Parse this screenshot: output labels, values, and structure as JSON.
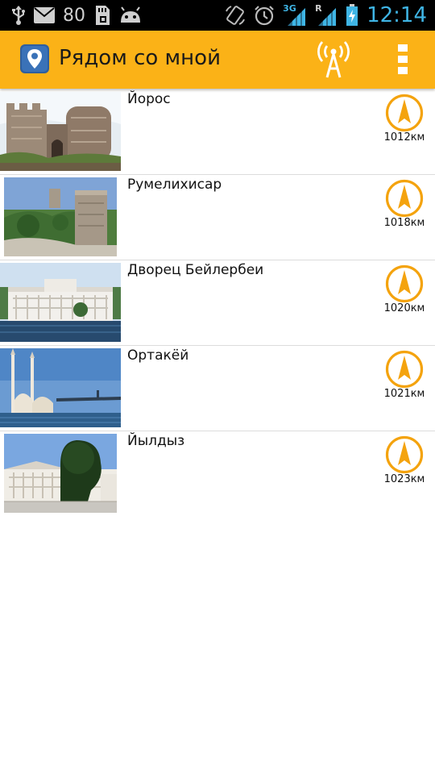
{
  "status_bar": {
    "battery_level": "80",
    "time": "12:14",
    "network": "3G",
    "roaming": "R",
    "icons": [
      "usb-icon",
      "mail-icon",
      "sd-card-icon",
      "android-icon",
      "rotate-icon",
      "alarm-icon",
      "signal-icon",
      "battery-icon"
    ]
  },
  "action_bar": {
    "title": "Рядом со мной",
    "icons": [
      "location-pin-icon",
      "antenna-icon",
      "overflow-menu-icon"
    ],
    "accent": "#fbb217"
  },
  "places": [
    {
      "name": "Йорос",
      "distance": "1012км",
      "photo": "fortress-photo"
    },
    {
      "name": "Румелихисар",
      "distance": "1018км",
      "photo": "castle-photo"
    },
    {
      "name": "Дворец Бейлербеи",
      "distance": "1020км",
      "photo": "palace-photo"
    },
    {
      "name": "Ортакёй",
      "distance": "1021км",
      "photo": "mosque-photo"
    },
    {
      "name": "Йылдыз",
      "distance": "1023км",
      "photo": "mansion-photo"
    }
  ],
  "colors": {
    "compass": "#f4a30e",
    "list_divider": "#dcdcdc"
  }
}
